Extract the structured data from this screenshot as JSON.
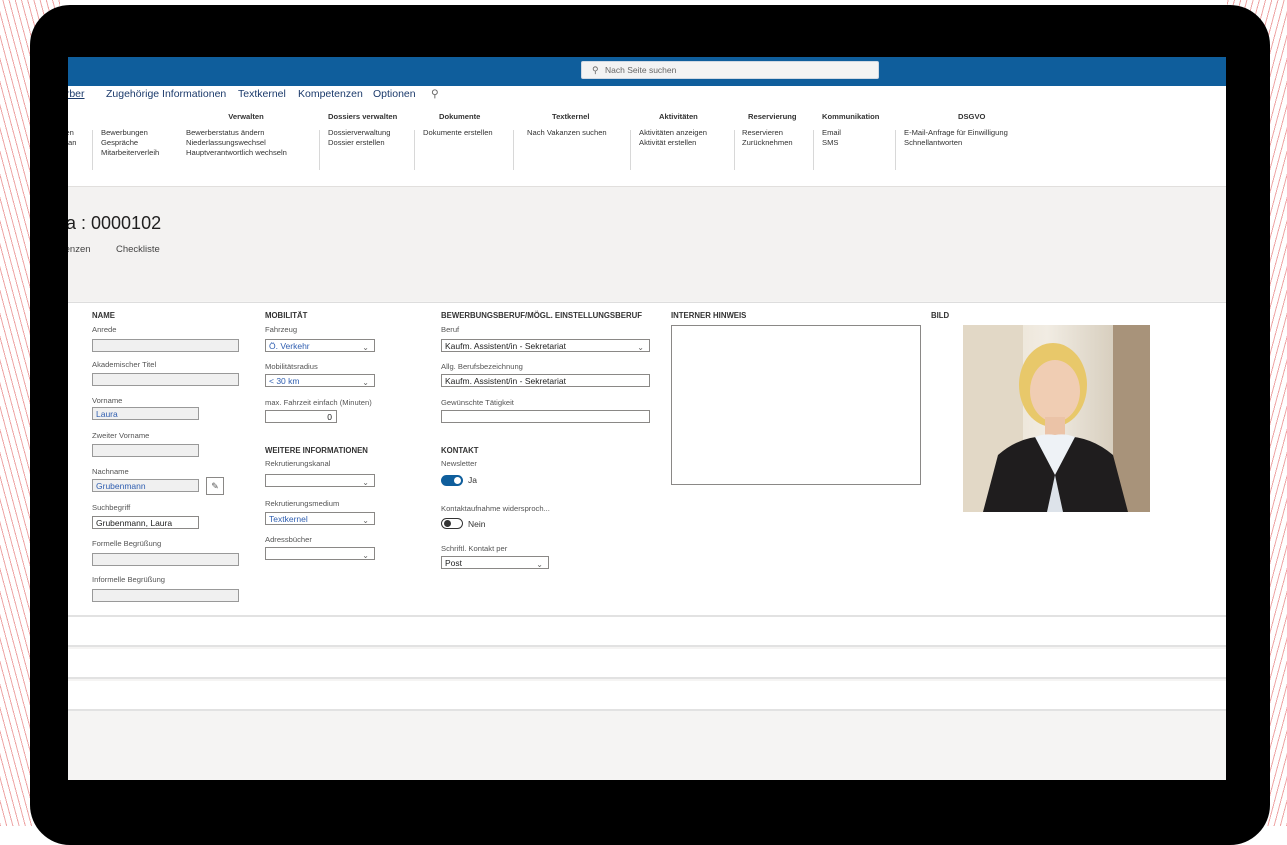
{
  "search": {
    "placeholder": "Nach Seite suchen"
  },
  "tabs": [
    "erber",
    "Zugehörige Informationen",
    "Textkernel",
    "Kompetenzen",
    "Optionen"
  ],
  "ribbon": {
    "left_items": [
      "llen",
      "an"
    ],
    "group2": {
      "items": [
        "Bewerbungen",
        "Gespräche",
        "Mitarbeiterverleih"
      ]
    },
    "verwalten": {
      "header": "Verwalten",
      "items": [
        "Bewerberstatus ändern",
        "Niederlassungswechsel",
        "Hauptverantwortlich wechseln"
      ]
    },
    "dossiers": {
      "header": "Dossiers verwalten",
      "items": [
        "Dossierverwaltung",
        "Dossier erstellen"
      ]
    },
    "dokumente": {
      "header": "Dokumente",
      "items": [
        "Dokumente erstellen"
      ]
    },
    "textkernel": {
      "header": "Textkernel",
      "items": [
        "Nach Vakanzen suchen"
      ]
    },
    "aktivitaeten": {
      "header": "Aktivitäten",
      "items": [
        "Aktivitäten anzeigen",
        "Aktivität erstellen"
      ]
    },
    "reservierung": {
      "header": "Reservierung",
      "items": [
        "Reservieren",
        "Zurücknehmen"
      ]
    },
    "kommunikation": {
      "header": "Kommunikation",
      "items": [
        "Email",
        "SMS"
      ]
    },
    "dsgvo": {
      "header": "DSGVO",
      "items": [
        "E-Mail-Anfrage für Einwilligung",
        "Schnellantworten"
      ]
    }
  },
  "record": {
    "title": "a : 0000102"
  },
  "subtabs": [
    "tenzen",
    "Checkliste"
  ],
  "name_section": {
    "header": "NAME",
    "anrede": {
      "label": "Anrede",
      "value": ""
    },
    "titel": {
      "label": "Akademischer Titel",
      "value": ""
    },
    "vorname": {
      "label": "Vorname",
      "value": "Laura"
    },
    "zweiter": {
      "label": "Zweiter Vorname",
      "value": ""
    },
    "nachname": {
      "label": "Nachname",
      "value": "Grubenmann"
    },
    "suchbegriff": {
      "label": "Suchbegriff",
      "value": "Grubenmann, Laura"
    },
    "formell": {
      "label": "Formelle Begrüßung",
      "value": ""
    },
    "informell": {
      "label": "Informelle Begrüßung",
      "value": ""
    }
  },
  "mobility": {
    "header": "MOBILITÄT",
    "fahrzeug": {
      "label": "Fahrzeug",
      "value": "Ö. Verkehr"
    },
    "radius": {
      "label": "Mobilitätsradius",
      "value": "< 30 km"
    },
    "fahrzeit": {
      "label": "max. Fahrzeit einfach (Minuten)",
      "value": "0"
    }
  },
  "weitere": {
    "header": "WEITERE INFORMATIONEN",
    "kanal": {
      "label": "Rekrutierungskanal",
      "value": ""
    },
    "medium": {
      "label": "Rekrutierungsmedium",
      "value": "Textkernel"
    },
    "adress": {
      "label": "Adressbücher",
      "value": ""
    }
  },
  "beruf_section": {
    "header": "BEWERBUNGSBERUF/MÖGL. EINSTELLUNGSBERUF",
    "beruf": {
      "label": "Beruf",
      "value": "Kaufm. Assistent/in - Sekretariat"
    },
    "bez": {
      "label": "Allg. Berufsbezeichnung",
      "value": "Kaufm. Assistent/in - Sekretariat"
    },
    "taet": {
      "label": "Gewünschte Tätigkeit",
      "value": ""
    }
  },
  "kontakt": {
    "header": "KONTAKT",
    "newsletter": {
      "label": "Newsletter",
      "value": "Ja"
    },
    "widerspruch": {
      "label": "Kontaktaufnahme widersproch...",
      "value": "Nein"
    },
    "schriftl": {
      "label": "Schriftl. Kontakt per",
      "value": "Post"
    }
  },
  "hinweis": {
    "header": "INTERNER HINWEIS"
  },
  "bild": {
    "header": "BILD"
  },
  "icons": {
    "search": "search-icon",
    "chevron": "chevron-down-icon",
    "edit": "pencil-icon"
  },
  "colors": {
    "topbar": "#0f5e9c",
    "toggle_on": "#0f5e9c"
  }
}
